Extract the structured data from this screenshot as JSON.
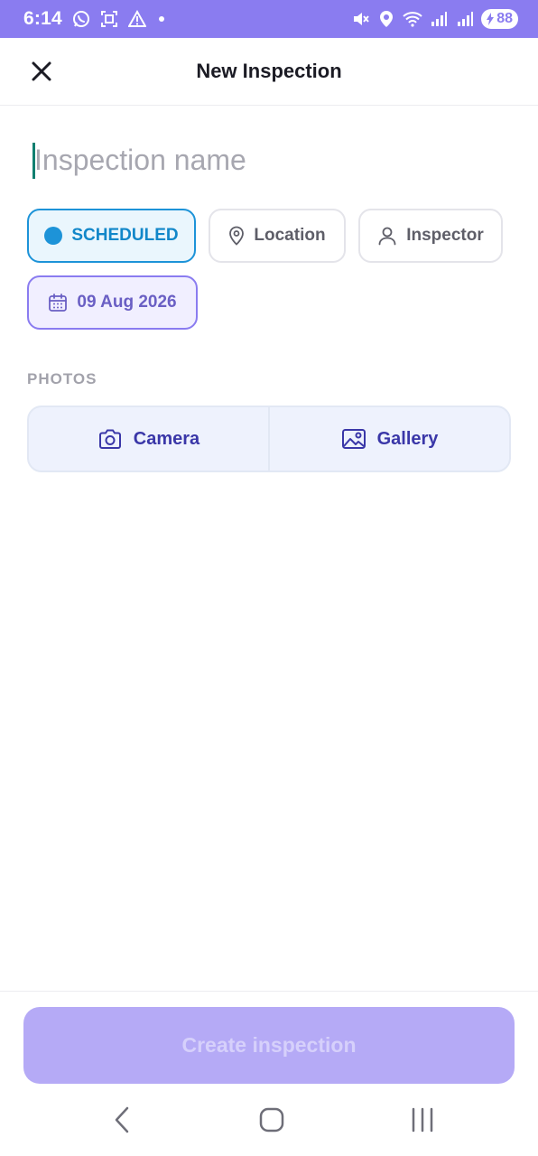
{
  "status_bar": {
    "time": "6:14",
    "battery": "88",
    "left_icons": [
      "whatsapp-icon",
      "screenshot-icon",
      "alert-icon",
      "dot-icon"
    ],
    "right_icons": [
      "mute-icon",
      "location-icon",
      "wifi-icon",
      "signal-icon",
      "signal-icon",
      "battery-icon"
    ],
    "background": "#8a7cf0"
  },
  "header": {
    "title": "New Inspection",
    "close_icon": "close-icon"
  },
  "form": {
    "name_placeholder": "Inspection name",
    "name_value": ""
  },
  "chips": {
    "status_label": "SCHEDULED",
    "status_color": "#1d93d8",
    "location_label": "Location",
    "inspector_label": "Inspector",
    "date_label": "09 Aug 2026"
  },
  "photos": {
    "section_label": "PHOTOS",
    "camera_label": "Camera",
    "gallery_label": "Gallery"
  },
  "footer": {
    "create_label": "Create inspection",
    "create_disabled": true,
    "accent": "#b5aaf6"
  },
  "nav": {
    "icons": [
      "back-icon",
      "home-icon",
      "recents-icon"
    ]
  }
}
